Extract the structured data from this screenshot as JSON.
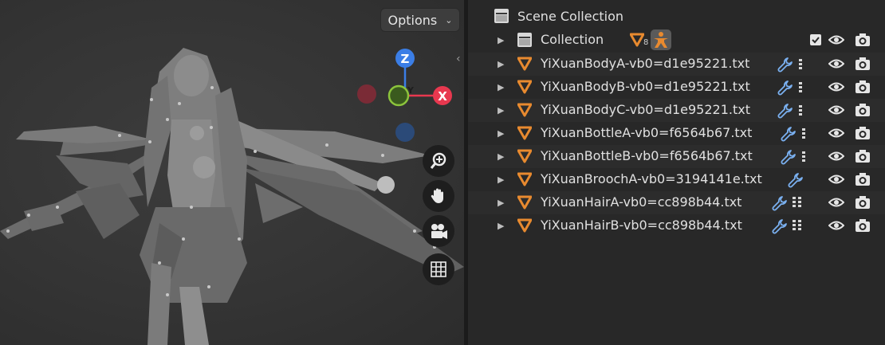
{
  "viewport": {
    "options_label": "Options",
    "gizmo": {
      "z_label": "Z",
      "x_label": "X",
      "y_label": "Y"
    },
    "colors": {
      "x": "#e8384f",
      "y": "#8cc43c",
      "z": "#3b7ee6"
    },
    "tools": [
      "zoom-icon",
      "hand-icon",
      "camera-icon",
      "grid-icon"
    ]
  },
  "outliner": {
    "root": {
      "label": "Scene Collection"
    },
    "collection": {
      "label": "Collection",
      "count": "8"
    },
    "objects": [
      {
        "label": "YiXuanBodyA-vb0=d1e95221.txt"
      },
      {
        "label": "YiXuanBodyB-vb0=d1e95221.txt"
      },
      {
        "label": "YiXuanBodyC-vb0=d1e95221.txt"
      },
      {
        "label": "YiXuanBottleA-vb0=f6564b67.txt"
      },
      {
        "label": "YiXuanBottleB-vb0=f6564b67.txt"
      },
      {
        "label": "YiXuanBroochA-vb0=3194141e.txt"
      },
      {
        "label": "YiXuanHairA-vb0=cc898b44.txt"
      },
      {
        "label": "YiXuanHairB-vb0=cc898b44.txt"
      }
    ],
    "colors": {
      "mesh": "#e88a2f",
      "modifier": "#7ab0f0"
    }
  }
}
